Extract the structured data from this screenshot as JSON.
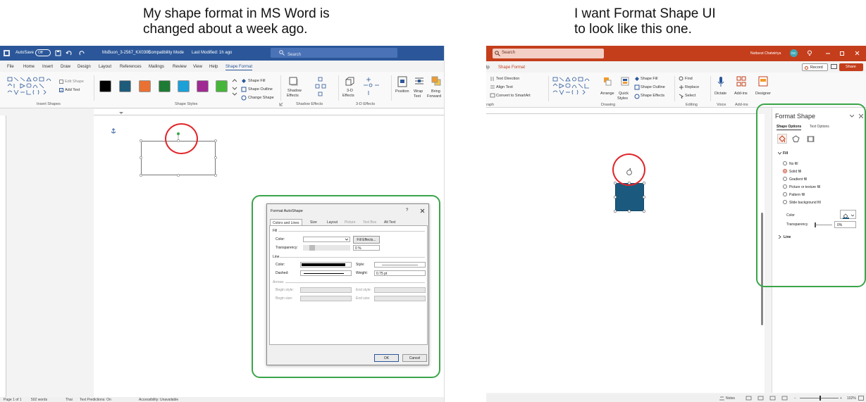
{
  "captions": {
    "left_line1": "My shape format in MS Word is",
    "left_line2": "changed about a week ago.",
    "right_line1": "I want Format Shape UI",
    "right_line2": "to look like this one."
  },
  "word": {
    "title": {
      "autosave": "AutoSave",
      "toggle": "Off",
      "filename": "MsBuon_3-2567_KX0305",
      "mode": "Compatibility Mode",
      "modified": "Last Modified: 1h ago",
      "search_placeholder": "Search"
    },
    "tabs": [
      "File",
      "Home",
      "Insert",
      "Draw",
      "Design",
      "Layout",
      "References",
      "Mailings",
      "Review",
      "View",
      "Help",
      "Shape Format"
    ],
    "ribbon": {
      "edit_shape": "Edit Shape",
      "add_text": "Add Text",
      "shape_fill": "Shape Fill",
      "shape_outline": "Shape Outline",
      "change_shape": "Change Shape",
      "shadow_effects_1": "Shadow",
      "shadow_effects_2": "Effects",
      "three_d_1": "3-D",
      "three_d_2": "Effects",
      "position": "Position",
      "wrap_1": "Wrap",
      "wrap_2": "Text",
      "bring_1": "Bring",
      "bring_2": "Forward",
      "group_insert_shapes": "Insert Shapes",
      "group_shape_styles": "Shape Styles",
      "group_shadow_effects": "Shadow Effects",
      "group_3d_effects": "3-D Effects"
    },
    "swatches": [
      "#000000",
      "#1e5b7a",
      "#e97132",
      "#1e7b34",
      "#1ca0d8",
      "#a02b93",
      "#46b63a"
    ],
    "status": {
      "page": "Page 1 of 1",
      "words": "502 words",
      "language": "Thai",
      "predictions": "Text Predictions: On",
      "accessibility": "Accessibility: Unavailable"
    },
    "dialog": {
      "title": "Format AutoShape",
      "help": "?",
      "tabs": [
        "Colors and Lines",
        "Size",
        "Layout",
        "Picture",
        "Text Box",
        "Alt Text"
      ],
      "fill_section": "Fill",
      "color_label": "Color:",
      "fill_effects": "Fill Effects...",
      "transparency_label": "Transparency:",
      "transparency_value": "0 %",
      "line_section": "Line",
      "line_color_label": "Color:",
      "style_label": "Style:",
      "dashed_label": "Dashed:",
      "weight_label": "Weight:",
      "weight_value": "0.75 pt",
      "arrows_section": "Arrows",
      "begin_style": "Begin style:",
      "end_style": "End style:",
      "begin_size": "Begin size:",
      "end_size": "End size:",
      "ok": "OK",
      "cancel": "Cancel"
    }
  },
  "ppt": {
    "title": {
      "search_placeholder": "Search",
      "user": "Nuttavut Chatwiriya",
      "initials": "NC"
    },
    "tabs": {
      "partial": "lp",
      "shape_format": "Shape Format",
      "record": "Record",
      "share": "Share"
    },
    "ribbon": {
      "text_direction": "Text Direction",
      "align_text": "Align Text",
      "convert_smartart": "Convert to SmartArt",
      "arrange": "Arrange",
      "quick_styles_1": "Quick",
      "quick_styles_2": "Styles",
      "shape_fill": "Shape Fill",
      "shape_outline": "Shape Outline",
      "shape_effects": "Shape Effects",
      "find": "Find",
      "replace": "Replace",
      "select": "Select",
      "dictate": "Dictate",
      "add_ins": "Add-ins",
      "designer": "Designer",
      "group_paragraph": "raph",
      "group_drawing": "Drawing",
      "group_editing": "Editing",
      "group_voice": "Voice",
      "group_addins": "Add-ins"
    },
    "pane": {
      "title": "Format Shape",
      "tab_shape": "Shape Options",
      "tab_text": "Text Options",
      "fill": "Fill",
      "options": [
        "No fill",
        "Solid fill",
        "Gradient fill",
        "Picture or texture fill",
        "Pattern fill",
        "Slide background fill"
      ],
      "selected_index": 1,
      "color": "Color",
      "transparency": "Transparency",
      "transparency_value": "0%",
      "line": "Line"
    },
    "status": {
      "notes": "Notes",
      "zoom": "102%"
    }
  },
  "colors": {
    "word_blue": "#2b579a",
    "ppt_orange": "#c43e1c",
    "shape_fill": "#1b5a7e",
    "highlight_red": "#e0262b",
    "highlight_green": "#3aa54a"
  }
}
